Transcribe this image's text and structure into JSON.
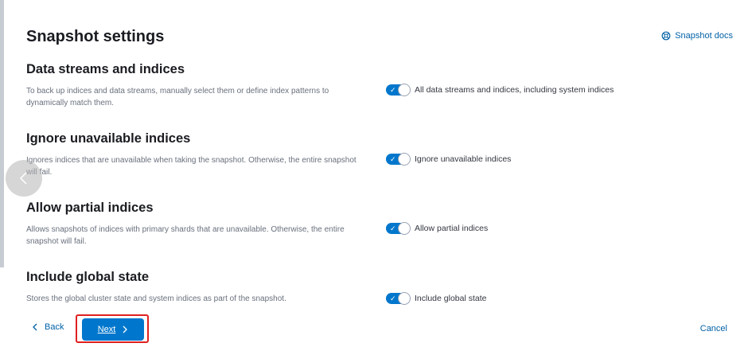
{
  "header": {
    "title": "Snapshot settings",
    "docs_link": "Snapshot docs"
  },
  "sections": [
    {
      "title": "Data streams and indices",
      "description": "To back up indices and data streams, manually select them or define index patterns to dynamically match them.",
      "toggle_label": "All data streams and indices, including system indices",
      "toggle_on": true
    },
    {
      "title": "Ignore unavailable indices",
      "description": "Ignores indices that are unavailable when taking the snapshot. Otherwise, the entire snapshot will fail.",
      "toggle_label": "Ignore unavailable indices",
      "toggle_on": true
    },
    {
      "title": "Allow partial indices",
      "description": "Allows snapshots of indices with primary shards that are unavailable. Otherwise, the entire snapshot will fail.",
      "toggle_label": "Allow partial indices",
      "toggle_on": true
    },
    {
      "title": "Include global state",
      "description": "Stores the global cluster state and system indices as part of the snapshot.",
      "toggle_label": "Include global state",
      "toggle_on": true
    }
  ],
  "footer": {
    "back_label": "Back",
    "next_label": "Next",
    "cancel_label": "Cancel"
  },
  "colors": {
    "accent": "#0077cc",
    "link": "#0061a6",
    "highlight": "#e02020"
  },
  "icons": {
    "docs": "help-circle-icon",
    "back": "chevron-left-icon",
    "next": "chevron-right-icon",
    "toggle": "check-icon",
    "carousel_prev": "carousel-prev-icon"
  }
}
